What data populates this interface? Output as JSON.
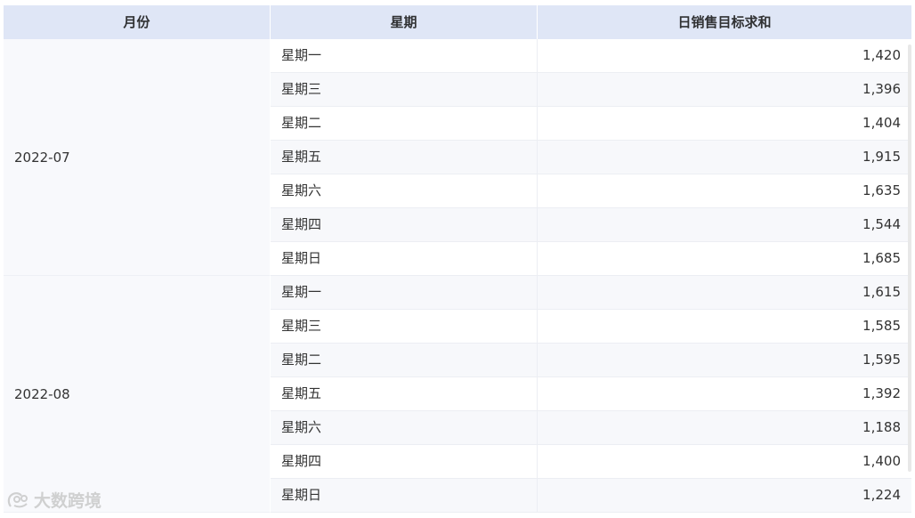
{
  "header": {
    "month": "月份",
    "weekday": "星期",
    "target_sum": "日销售目标求和"
  },
  "groups": [
    {
      "month": "2022-07",
      "rows": [
        {
          "weekday": "星期一",
          "value": "1,420"
        },
        {
          "weekday": "星期三",
          "value": "1,396"
        },
        {
          "weekday": "星期二",
          "value": "1,404"
        },
        {
          "weekday": "星期五",
          "value": "1,915"
        },
        {
          "weekday": "星期六",
          "value": "1,635"
        },
        {
          "weekday": "星期四",
          "value": "1,544"
        },
        {
          "weekday": "星期日",
          "value": "1,685"
        }
      ]
    },
    {
      "month": "2022-08",
      "rows": [
        {
          "weekday": "星期一",
          "value": "1,615"
        },
        {
          "weekday": "星期三",
          "value": "1,585"
        },
        {
          "weekday": "星期二",
          "value": "1,595"
        },
        {
          "weekday": "星期五",
          "value": "1,392"
        },
        {
          "weekday": "星期六",
          "value": "1,188"
        },
        {
          "weekday": "星期四",
          "value": "1,400"
        },
        {
          "weekday": "星期日",
          "value": "1,224"
        }
      ]
    }
  ],
  "watermark": {
    "text": "大数跨境"
  }
}
